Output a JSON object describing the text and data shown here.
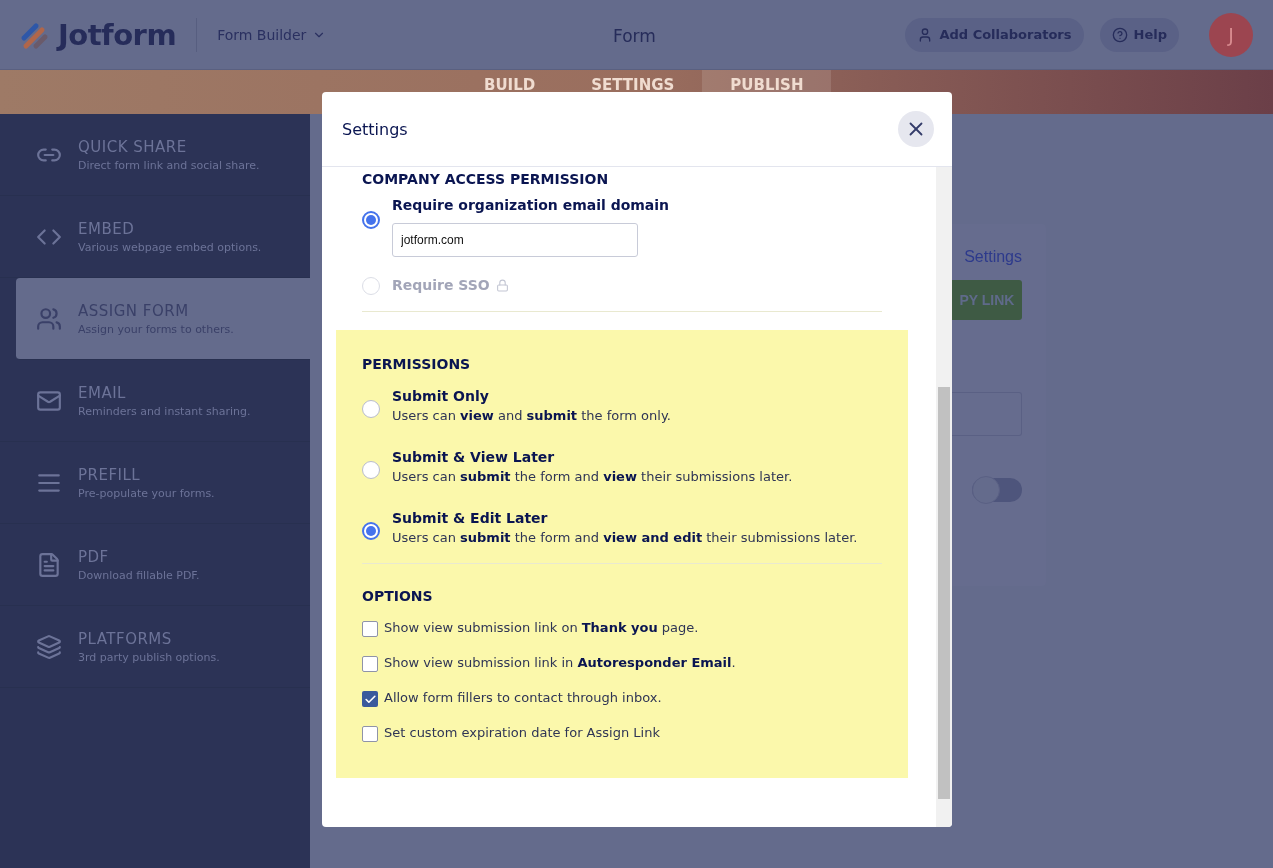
{
  "topbar": {
    "logo": "Jotform",
    "builder": "Form Builder",
    "title": "Form",
    "buttons": [
      {
        "kind": "collab",
        "label": "Add Collaborators"
      },
      {
        "kind": "help",
        "label": "Help"
      }
    ],
    "avatar": "J"
  },
  "tabs": [
    {
      "label": "BUILD",
      "selected": false
    },
    {
      "label": "SETTINGS",
      "selected": false
    },
    {
      "label": "PUBLISH",
      "selected": true
    }
  ],
  "sidebar": {
    "items": [
      {
        "kind": "link",
        "title": "QUICK SHARE",
        "subtitle": "Direct form link and social share.",
        "selected": false
      },
      {
        "kind": "code",
        "title": "EMBED",
        "subtitle": "Various webpage embed options.",
        "selected": false
      },
      {
        "kind": "users",
        "title": "ASSIGN FORM",
        "subtitle": "Assign your forms to others.",
        "selected": true
      },
      {
        "kind": "mail",
        "title": "EMAIL",
        "subtitle": "Reminders and instant sharing.",
        "selected": false
      },
      {
        "kind": "prefill",
        "title": "PREFILL",
        "subtitle": "Pre-populate your forms.",
        "selected": false
      },
      {
        "kind": "pdf",
        "title": "PDF",
        "subtitle": "Download fillable PDF.",
        "selected": false
      },
      {
        "kind": "layers",
        "title": "PLATFORMS",
        "subtitle": "3rd party publish options.",
        "selected": false
      }
    ]
  },
  "background_card": {
    "link": "Settings",
    "button": "PY LINK",
    "toggle_on": false
  },
  "modal": {
    "title": "Settings",
    "company": {
      "title": "COMPANY ACCESS PERMISSION",
      "options": [
        {
          "label": "Require organization email domain",
          "selected": true,
          "disabled": false,
          "value": "jotform.com"
        },
        {
          "label": "Require SSO",
          "selected": false,
          "disabled": true,
          "locked": true
        }
      ]
    },
    "permissions": {
      "title": "PERMISSIONS",
      "options": [
        {
          "label": "Submit Only",
          "description": "Users can **view** and **submit** the form only.",
          "selected": false
        },
        {
          "label": "Submit & View Later",
          "description": "Users can **submit** the form and **view** their submissions later.",
          "selected": false
        },
        {
          "label": "Submit & Edit Later",
          "description": "Users can **submit** the form and **view and edit** their submissions later.",
          "selected": true
        }
      ]
    },
    "options": {
      "title": "OPTIONS",
      "items": [
        {
          "label": "Show view submission link on **Thank you** page.",
          "checked": false
        },
        {
          "label": "Show view submission link in **Autoresponder Email**.",
          "checked": false
        },
        {
          "label": "Allow form fillers to contact through inbox.",
          "checked": true
        },
        {
          "label": "Set custom expiration date for Assign Link",
          "checked": false
        }
      ]
    }
  }
}
